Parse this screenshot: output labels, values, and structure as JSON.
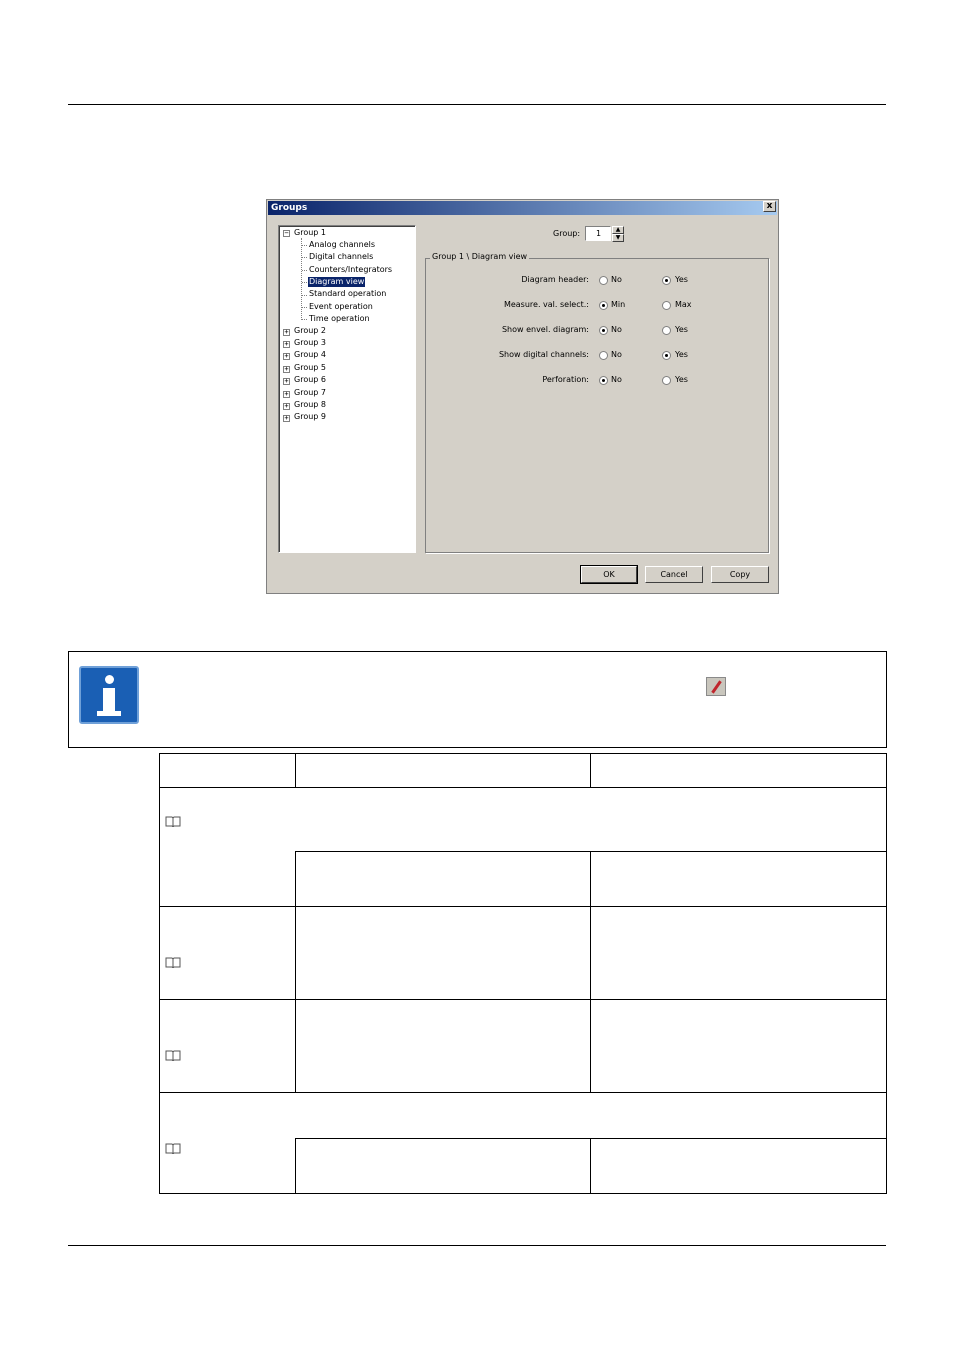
{
  "dialog": {
    "title": "Groups",
    "close_glyph": "x",
    "tree": {
      "expanded_group": "Group 1",
      "children": [
        "Analog channels",
        "Digital channels",
        "Counters/Integrators",
        "Diagram view",
        "Standard operation",
        "Event operation",
        "Time operation"
      ],
      "selected": "Diagram view",
      "collapsed_groups": [
        "Group 2",
        "Group 3",
        "Group 4",
        "Group 5",
        "Group 6",
        "Group 7",
        "Group 8",
        "Group 9"
      ]
    },
    "group_label": "Group:",
    "group_value": "1",
    "spin_up": "▲",
    "spin_down": "▼",
    "frame_title": "Group 1 \\ Diagram view",
    "options": [
      {
        "label": "Diagram header:",
        "opt1": "No",
        "opt2": "Yes",
        "selected": 2
      },
      {
        "label": "Measure. val. select.:",
        "opt1": "Min",
        "opt2": "Max",
        "selected": 1
      },
      {
        "label": "Show envel. diagram:",
        "opt1": "No",
        "opt2": "Yes",
        "selected": 1
      },
      {
        "label": "Show digital channels:",
        "opt1": "No",
        "opt2": "Yes",
        "selected": 2
      },
      {
        "label": "Perforation:",
        "opt1": "No",
        "opt2": "Yes",
        "selected": 1
      }
    ],
    "buttons": {
      "ok": "OK",
      "cancel": "Cancel",
      "copy": "Copy"
    }
  },
  "icons": {
    "info": "info-icon",
    "wrench": "screwdriver-icon",
    "book": "book-icon"
  }
}
